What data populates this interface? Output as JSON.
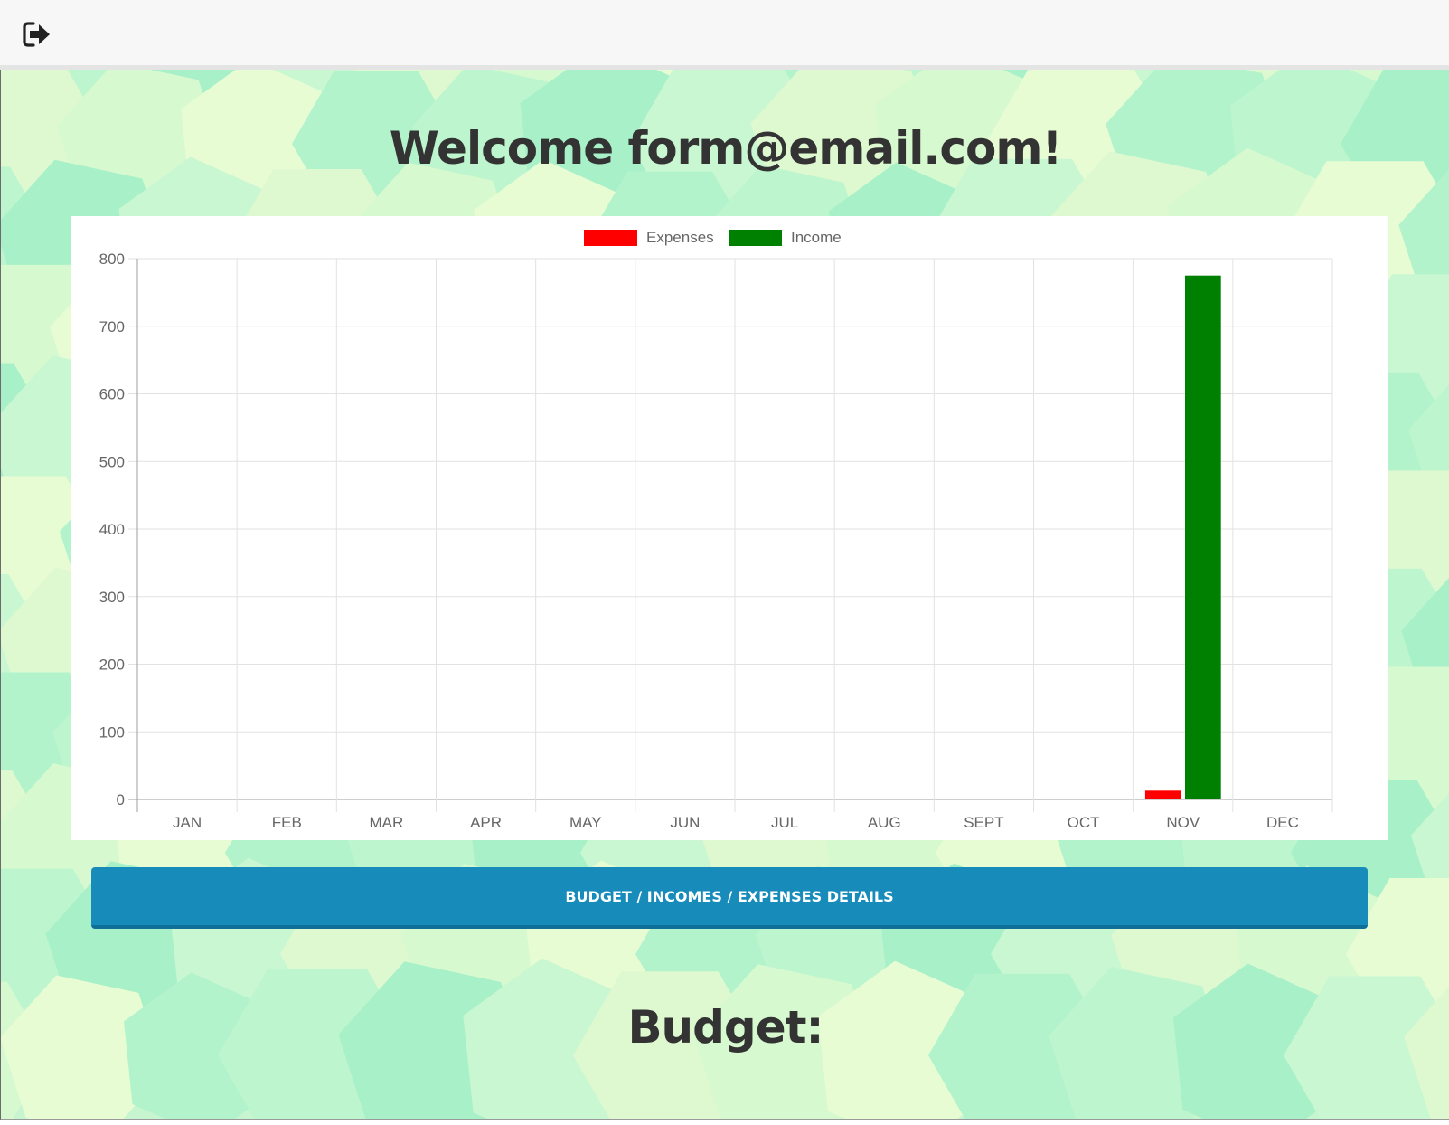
{
  "header": {
    "logout_icon": "sign-out-icon"
  },
  "main": {
    "welcome_text": "Welcome form@email.com!",
    "details_button_label": "BUDGET / INCOMES / EXPENSES DETAILS",
    "budget_title": "Budget:"
  },
  "colors": {
    "expenses": "#ff0000",
    "income": "#008000",
    "button": "#178cba",
    "heading": "#333333"
  },
  "chart_data": {
    "type": "bar",
    "categories": [
      "JAN",
      "FEB",
      "MAR",
      "APR",
      "MAY",
      "JUN",
      "JUL",
      "AUG",
      "SEPT",
      "OCT",
      "NOV",
      "DEC"
    ],
    "series": [
      {
        "name": "Expenses",
        "color": "#ff0000",
        "values": [
          0,
          0,
          0,
          0,
          0,
          0,
          0,
          0,
          0,
          0,
          13,
          0
        ]
      },
      {
        "name": "Income",
        "color": "#008000",
        "values": [
          0,
          0,
          0,
          0,
          0,
          0,
          0,
          0,
          0,
          0,
          775,
          0
        ]
      }
    ],
    "yticks": [
      0,
      100,
      200,
      300,
      400,
      500,
      600,
      700,
      800
    ],
    "ylim": [
      0,
      800
    ],
    "grid": true,
    "legend": "top-center",
    "title": "",
    "xlabel": "",
    "ylabel": ""
  }
}
